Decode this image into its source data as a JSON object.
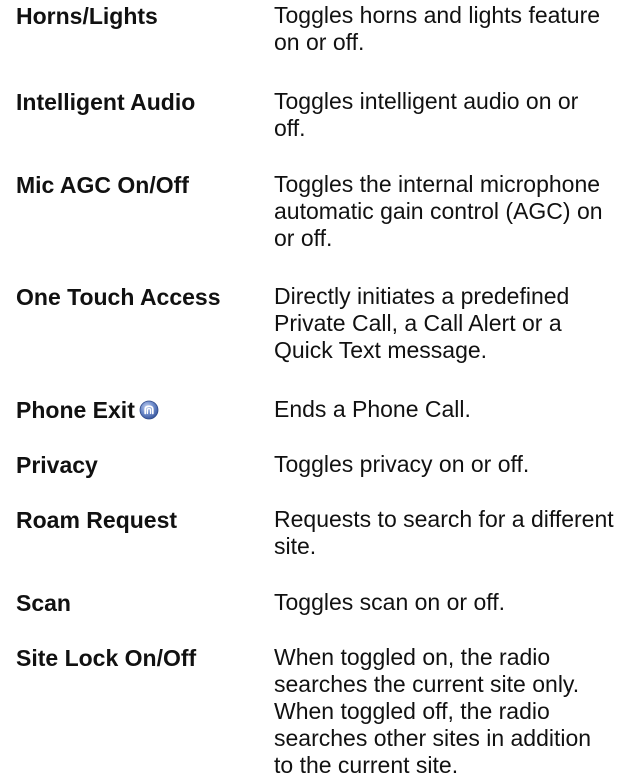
{
  "features": [
    {
      "term": "Horns/Lights",
      "description": "Toggles horns and lights feature on or off."
    },
    {
      "term": "Intelligent Audio",
      "description": "Toggles intelligent audio on or off."
    },
    {
      "term": "Mic AGC On/Off",
      "description": "Toggles the internal microphone automatic gain control (AGC) on or off."
    },
    {
      "term": "One Touch Access",
      "description": "Directly initiates a predefined Private Call, a Call Alert or a Quick Text message."
    },
    {
      "term": "Phone Exit",
      "description": "Ends a Phone Call.",
      "icon": "phone-exit-icon"
    },
    {
      "term": "Privacy",
      "description": "Toggles privacy on or off."
    },
    {
      "term": "Roam Request",
      "description": "Requests to search for a different site."
    },
    {
      "term": "Scan",
      "description": "Toggles scan on or off."
    },
    {
      "term": "Site Lock On/Off",
      "description": "When toggled on, the radio searches the current site only. When toggled off, the radio searches other sites in addition to the current site."
    }
  ],
  "colors": {
    "text": "#111111",
    "icon_blue": "#4a6bb5"
  }
}
